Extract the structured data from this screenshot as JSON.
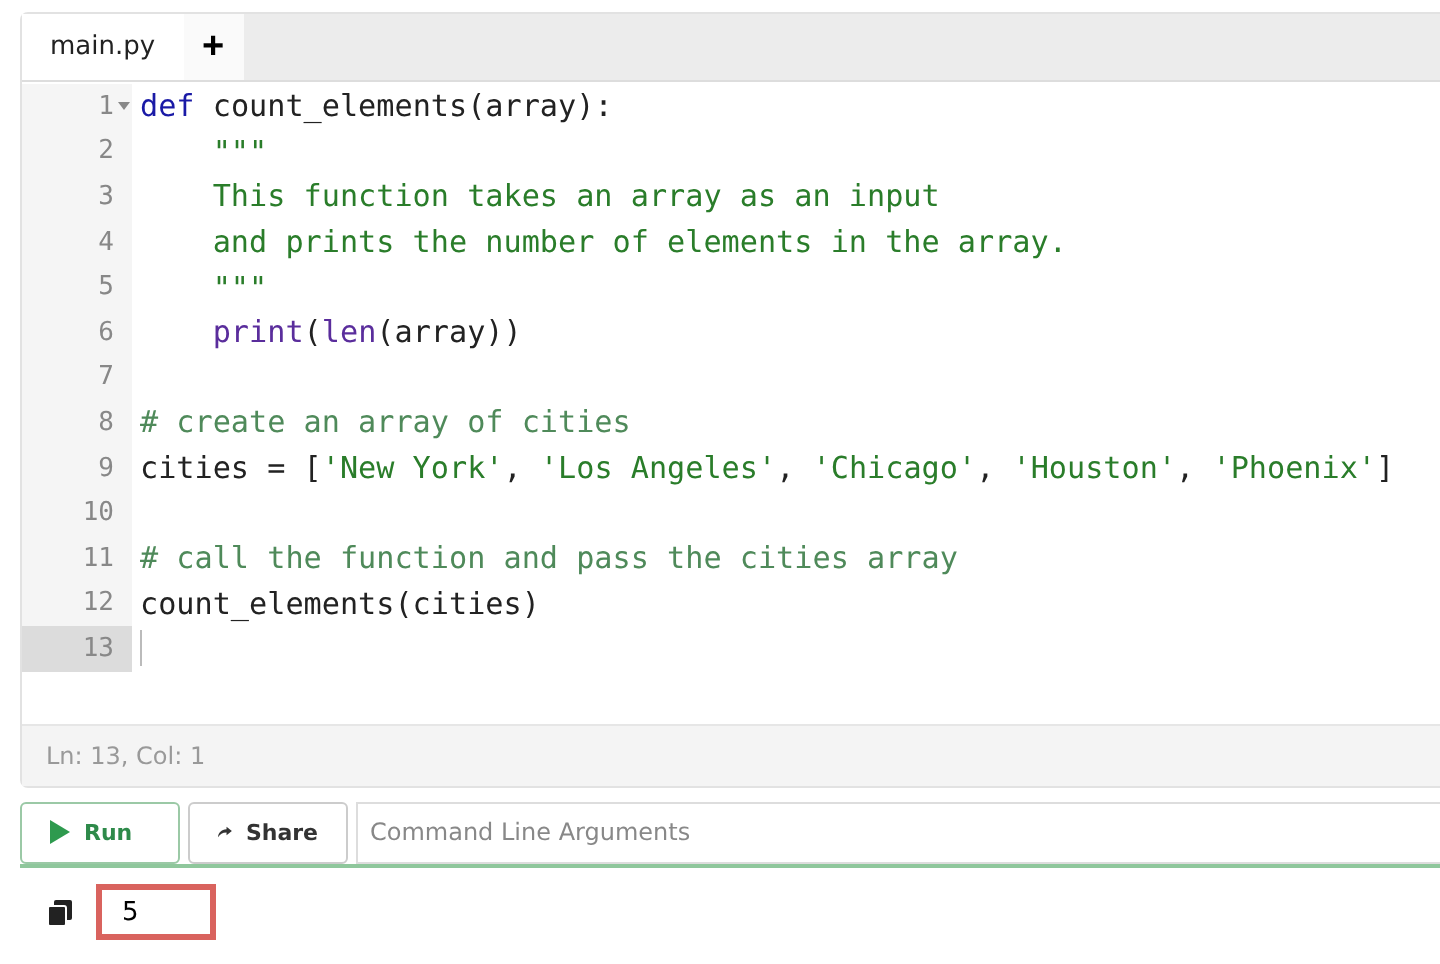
{
  "tabs": [
    {
      "label": "main.py",
      "selected": true
    }
  ],
  "new_tab_button": "+",
  "editor": {
    "lines": [
      {
        "number": "1",
        "fold": true,
        "current": false,
        "tokens": [
          {
            "kind": "keyword",
            "text": "def "
          },
          {
            "kind": "plain",
            "text": "count_elements(array):"
          }
        ]
      },
      {
        "number": "2",
        "fold": false,
        "current": false,
        "tokens": [
          {
            "kind": "string",
            "text": "    \"\"\""
          }
        ]
      },
      {
        "number": "3",
        "fold": false,
        "current": false,
        "tokens": [
          {
            "kind": "string",
            "text": "    This function takes an array as an input"
          }
        ]
      },
      {
        "number": "4",
        "fold": false,
        "current": false,
        "tokens": [
          {
            "kind": "string",
            "text": "    and prints the number of elements in the array."
          }
        ]
      },
      {
        "number": "5",
        "fold": false,
        "current": false,
        "tokens": [
          {
            "kind": "string",
            "text": "    \"\"\""
          }
        ]
      },
      {
        "number": "6",
        "fold": false,
        "current": false,
        "tokens": [
          {
            "kind": "builtin",
            "text": "    print"
          },
          {
            "kind": "plain",
            "text": "("
          },
          {
            "kind": "builtin",
            "text": "len"
          },
          {
            "kind": "plain",
            "text": "(array))"
          }
        ]
      },
      {
        "number": "7",
        "fold": false,
        "current": false
      },
      {
        "number": "8",
        "fold": false,
        "current": false,
        "tokens": [
          {
            "kind": "comment",
            "text": "# create an array of cities"
          }
        ]
      },
      {
        "number": "9",
        "fold": false,
        "current": false,
        "tokens": [
          {
            "kind": "plain",
            "text": "cities = ["
          },
          {
            "kind": "string",
            "text": "'New York'"
          },
          {
            "kind": "plain",
            "text": ", "
          },
          {
            "kind": "string",
            "text": "'Los Angeles'"
          },
          {
            "kind": "plain",
            "text": ", "
          },
          {
            "kind": "string",
            "text": "'Chicago'"
          },
          {
            "kind": "plain",
            "text": ", "
          },
          {
            "kind": "string",
            "text": "'Houston'"
          },
          {
            "kind": "plain",
            "text": ", "
          },
          {
            "kind": "string",
            "text": "'Phoenix'"
          },
          {
            "kind": "plain",
            "text": "]"
          }
        ]
      },
      {
        "number": "10",
        "fold": false,
        "current": false
      },
      {
        "number": "11",
        "fold": false,
        "current": false,
        "tokens": [
          {
            "kind": "comment",
            "text": "# call the function and pass the cities array"
          }
        ]
      },
      {
        "number": "12",
        "fold": false,
        "current": false,
        "tokens": [
          {
            "kind": "plain",
            "text": "count_elements(cities)"
          }
        ]
      },
      {
        "number": "13",
        "fold": false,
        "current": true
      }
    ]
  },
  "status_bar": "Ln: 13,  Col: 1",
  "toolbar": {
    "run_button": "Run",
    "share_button": "Share",
    "arguments_field": {
      "placeholder": "Command Line Arguments"
    }
  },
  "output": {
    "text": "5",
    "highlighted": true
  }
}
